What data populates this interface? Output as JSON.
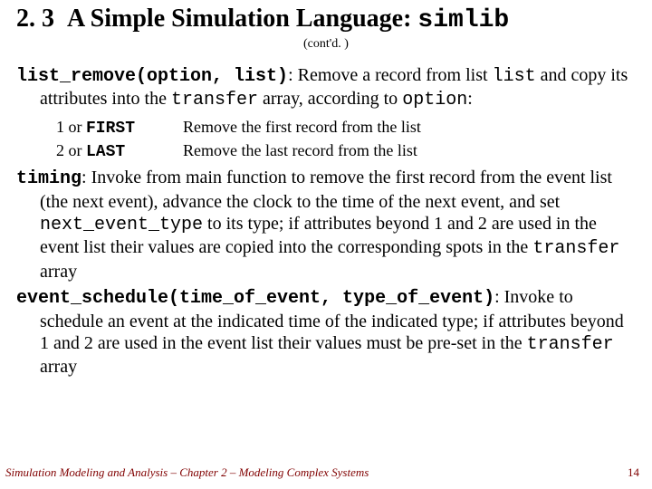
{
  "header": {
    "section_number": "2. 3",
    "title_text": "A Simple Simulation Language:",
    "title_code": "simlib",
    "contd": "(cont'd. )"
  },
  "list_remove": {
    "signature": "list_remove(option, list)",
    "desc_pre": ":  Remove a record from list ",
    "arg_list": "list",
    "desc_mid1": " and copy its attributes into the ",
    "transfer": "transfer",
    "desc_mid2": " array, according to ",
    "arg_option": "option",
    "desc_end": ":",
    "options": [
      {
        "keynum": "1",
        "or": " or ",
        "keycode": "FIRST",
        "val": "Remove the first record from the list"
      },
      {
        "keynum": "2",
        "or": " or ",
        "keycode": "LAST",
        "val": "Remove the last record from the list"
      }
    ]
  },
  "timing": {
    "name": "timing",
    "desc1": ":  Invoke from main function to remove the first record from the event list (the next event), advance the clock to the time of the next event, and set ",
    "next_event_type": "next_event_type",
    "desc2": " to its type; if attributes beyond 1 and 2 are used in the event list their values are copied into the corresponding spots in the ",
    "transfer": "transfer",
    "desc3": " array"
  },
  "event_schedule": {
    "signature": "event_schedule(time_of_event, type_of_event)",
    "desc1": ": Invoke to schedule an event at the indicated time of the indicated type; if attributes beyond 1 and 2 are used in the event list their values must be pre-set in the ",
    "transfer": "transfer",
    "desc2": " array"
  },
  "footer": {
    "text": "Simulation Modeling and Analysis – Chapter 2 – Modeling Complex Systems",
    "page": "14"
  }
}
